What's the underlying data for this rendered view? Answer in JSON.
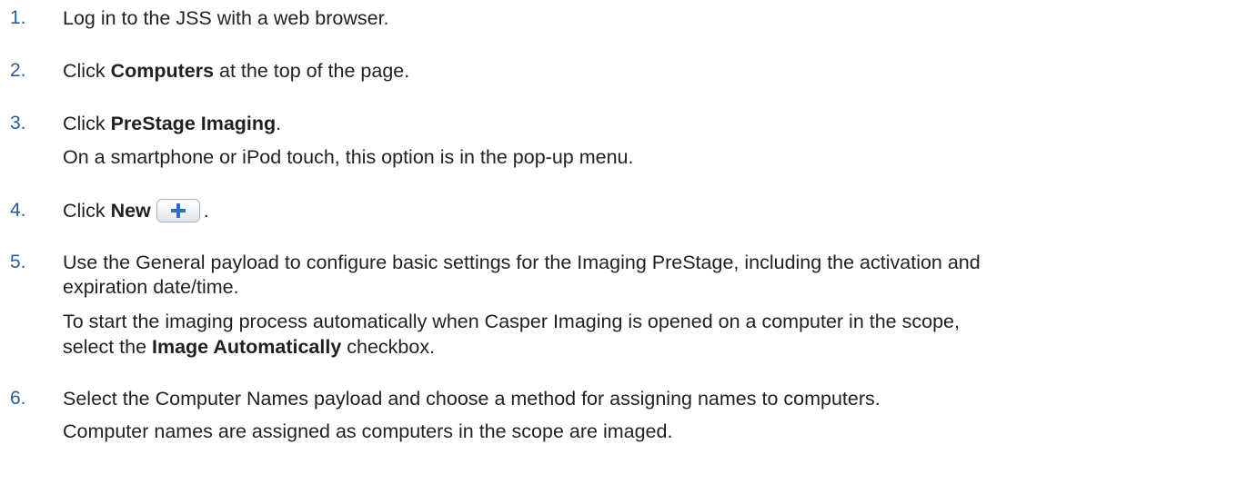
{
  "steps": [
    {
      "number": "1.",
      "lines": [
        [
          {
            "text": "Log in to the JSS with a web browser.",
            "bold": false
          }
        ]
      ]
    },
    {
      "number": "2.",
      "lines": [
        [
          {
            "text": "Click ",
            "bold": false
          },
          {
            "text": "Computers",
            "bold": true
          },
          {
            "text": " at the top of the page.",
            "bold": false
          }
        ]
      ]
    },
    {
      "number": "3.",
      "lines": [
        [
          {
            "text": "Click ",
            "bold": false
          },
          {
            "text": "PreStage Imaging",
            "bold": true
          },
          {
            "text": ".",
            "bold": false
          }
        ],
        [
          {
            "text": "On a smartphone or iPod touch, this option is in the pop-up menu.",
            "bold": false
          }
        ]
      ]
    },
    {
      "number": "4.",
      "lines": [
        [
          {
            "text": "Click ",
            "bold": false
          },
          {
            "text": "New",
            "bold": true
          },
          {
            "button": "plus-icon"
          },
          {
            "text": ".",
            "bold": false
          }
        ]
      ]
    },
    {
      "number": "5.",
      "lines": [
        [
          {
            "text": "Use the General payload to configure basic settings for the Imaging PreStage, including the activation and",
            "bold": false
          }
        ],
        [
          {
            "text": "expiration date/time.",
            "bold": false
          }
        ],
        [
          {
            "text": "To start the imaging process automatically when Casper Imaging is opened on a computer in the scope,",
            "bold": false
          }
        ],
        [
          {
            "text": "select the ",
            "bold": false
          },
          {
            "text": "Image Automatically",
            "bold": true
          },
          {
            "text": " checkbox.",
            "bold": false
          }
        ]
      ]
    },
    {
      "number": "6.",
      "lines": [
        [
          {
            "text": "Select the Computer Names payload and choose a method for assigning names to computers.",
            "bold": false
          }
        ],
        [
          {
            "text": "Computer names are assigned as computers in the scope are imaged.",
            "bold": false
          }
        ]
      ]
    }
  ],
  "colors": {
    "number": "#2b5c9a",
    "text": "#231f20",
    "plus": "#2f6fb6"
  }
}
